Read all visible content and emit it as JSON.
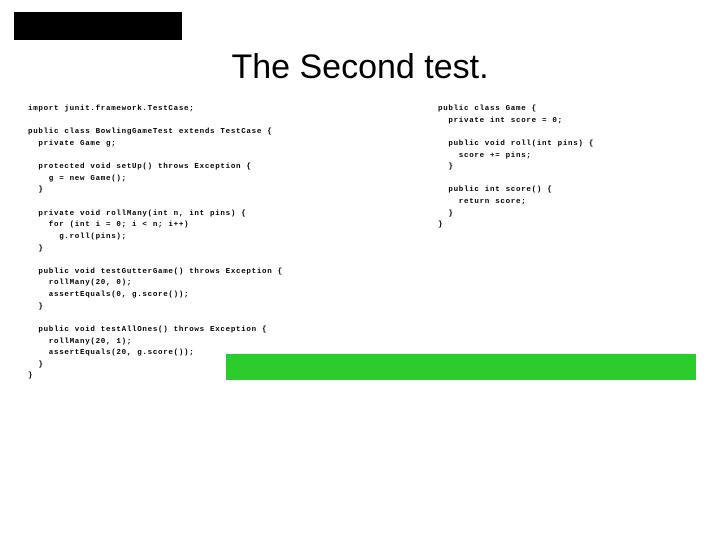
{
  "title": "The Second test.",
  "left_code": "import junit.framework.TestCase;\n\npublic class BowlingGameTest extends TestCase {\n  private Game g;\n\n  protected void setUp() throws Exception {\n    g = new Game();\n  }\n\n  private void rollMany(int n, int pins) {\n    for (int i = 0; i < n; i++)\n      g.roll(pins);\n  }\n\n  public void testGutterGame() throws Exception {\n    rollMany(20, 0);\n    assertEquals(0, g.score());\n  }\n\n  public void testAllOnes() throws Exception {\n    rollMany(20, 1);\n    assertEquals(20, g.score());\n  }\n}",
  "right_code": "public class Game {\n  private int score = 0;\n\n  public void roll(int pins) {\n    score += pins;\n  }\n\n  public int score() {\n    return score;\n  }\n}"
}
